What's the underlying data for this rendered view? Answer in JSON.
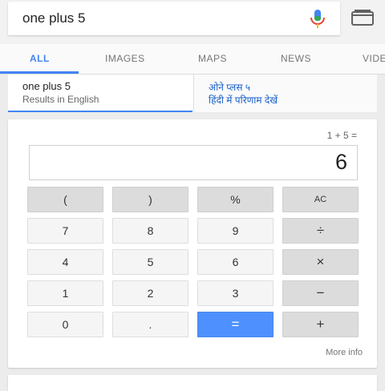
{
  "search": {
    "query": "one plus 5"
  },
  "tabs": [
    {
      "label": "ALL",
      "active": true
    },
    {
      "label": "IMAGES"
    },
    {
      "label": "MAPS"
    },
    {
      "label": "NEWS"
    },
    {
      "label": "VIDE"
    }
  ],
  "language": {
    "left": {
      "title": "one plus 5",
      "subtitle": "Results in English"
    },
    "right": {
      "title": "ओने प्लस ५",
      "subtitle": "हिंदी में परिणाम देखें"
    }
  },
  "calculator": {
    "expression": "1 + 5 =",
    "display": "6",
    "keys": [
      [
        "(",
        ")",
        "%",
        "AC"
      ],
      [
        "7",
        "8",
        "9",
        "÷"
      ],
      [
        "4",
        "5",
        "6",
        "×"
      ],
      [
        "1",
        "2",
        "3",
        "−"
      ],
      [
        "0",
        ".",
        "=",
        "+"
      ]
    ],
    "more_info": "More info"
  },
  "colors": {
    "accent": "#4285f4",
    "equals": "#4d90fe"
  },
  "icons": {
    "mic": "mic-icon",
    "tabs": "tabs-icon"
  }
}
